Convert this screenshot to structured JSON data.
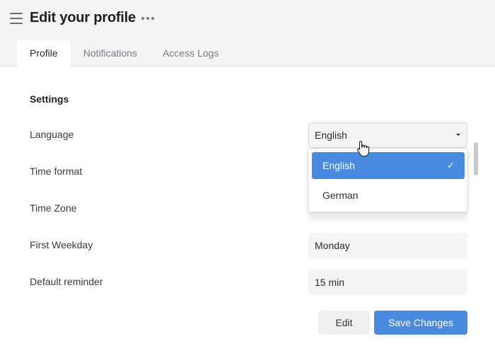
{
  "header": {
    "title": "Edit your profile",
    "tabs": [
      {
        "label": "Profile",
        "active": true
      },
      {
        "label": "Notifications",
        "active": false
      },
      {
        "label": "Access Logs",
        "active": false
      }
    ]
  },
  "settings": {
    "section_title": "Settings",
    "language": {
      "label": "Language",
      "value": "English"
    },
    "time_format": {
      "label": "Time format"
    },
    "time_zone": {
      "label": "Time Zone"
    },
    "first_weekday": {
      "label": "First Weekday",
      "value": "Monday"
    },
    "default_reminder": {
      "label": "Default reminder",
      "value": "15 min"
    }
  },
  "language_dropdown": {
    "options": [
      {
        "label": "English",
        "selected": true
      },
      {
        "label": "German",
        "selected": false
      }
    ],
    "check_glyph": "✓"
  },
  "actions": {
    "edit_label": "Edit",
    "save_label": "Save Changes"
  },
  "colors": {
    "accent": "#4a8be0",
    "header_bg": "#f4f4f6"
  },
  "icons": [
    "menu-icon",
    "more-icon",
    "caret-down-icon",
    "check-icon",
    "hand-cursor-icon"
  ]
}
